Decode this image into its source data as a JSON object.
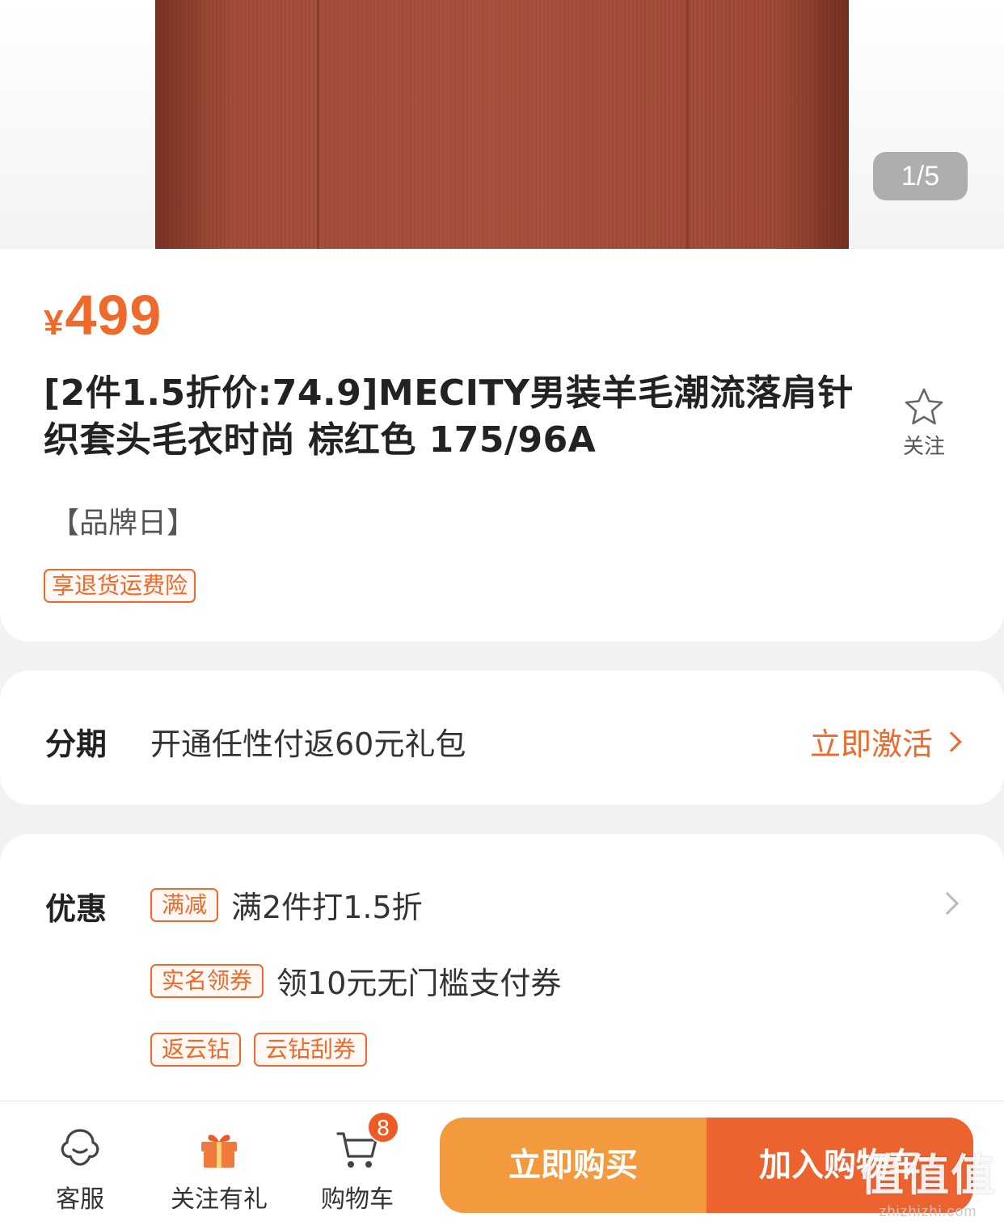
{
  "carousel": {
    "pager": "1/5"
  },
  "product": {
    "currency": "¥",
    "price": "499",
    "title": "[2件1.5折价:74.9]MECITY男装羊毛潮流落肩针织套头毛衣时尚 棕红色 175/96A",
    "follow_label": "关注",
    "brand_day": "【品牌日】",
    "insurance_tag": "享退货运费险"
  },
  "installment": {
    "label": "分期",
    "text": "开通任性付返60元礼包",
    "action": "立即激活"
  },
  "promotions": {
    "label": "优惠",
    "rows": [
      {
        "tag": "满减",
        "text": "满2件打1.5折"
      },
      {
        "tag": "实名领券",
        "text": "领10元无门槛支付券"
      }
    ],
    "extra_tags": [
      "返云钻",
      "云钻刮券"
    ]
  },
  "bottom_bar": {
    "service_label": "客服",
    "gift_label": "关注有礼",
    "cart_label": "购物车",
    "cart_count": "8",
    "buy_now": "立即购买",
    "add_to_cart": "加入购物车"
  },
  "watermark": {
    "main": "值值值",
    "sub": "zhizhizhi.com"
  },
  "colors": {
    "accent": "#ef6a2a",
    "buy_button": "#f29a3d",
    "cart_button": "#ec6330",
    "badge": "#ef5a24"
  },
  "icons": [
    "star-icon",
    "chevron-right-icon",
    "service-icon",
    "gift-icon",
    "cart-icon"
  ]
}
